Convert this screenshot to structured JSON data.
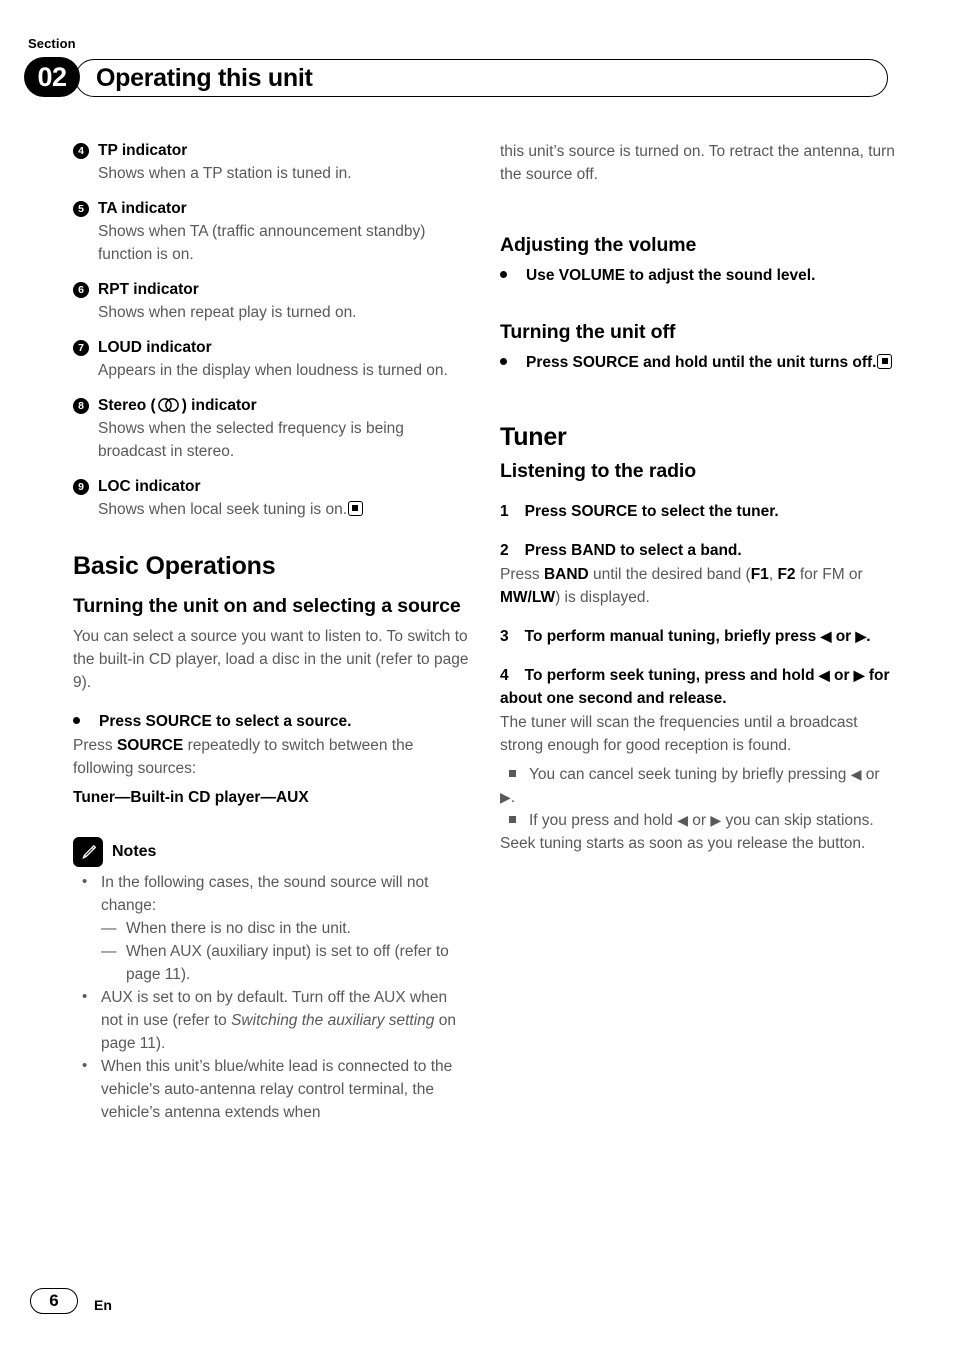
{
  "header": {
    "section_label": "Section",
    "section_number": "02",
    "title": "Operating this unit"
  },
  "left_column": {
    "indicators": [
      {
        "number": "4",
        "title": "TP indicator",
        "body": "Shows when a TP station is tuned in."
      },
      {
        "number": "5",
        "title": "TA indicator",
        "body": "Shows when TA (traffic announcement standby) function is on."
      },
      {
        "number": "6",
        "title": "RPT indicator",
        "body": "Shows when repeat play is turned on."
      },
      {
        "number": "7",
        "title": "LOUD indicator",
        "body": "Appears in the display when loudness is turned on."
      },
      {
        "number": "8",
        "title_before": "Stereo (",
        "title_symbol": "stereo-symbol",
        "title_after": ") indicator",
        "body": "Shows when the selected frequency is being broadcast in stereo."
      },
      {
        "number": "9",
        "title": "LOC indicator",
        "body": "Shows when local seek tuning is on."
      }
    ],
    "basic_operations_heading": "Basic Operations",
    "turning_on_heading": "Turning the unit on and selecting a source",
    "turning_on_para": "You can select a source you want to listen to. To switch to the built-in CD player, load a disc in the unit (refer to page 9).",
    "press_source_bullet": "Press SOURCE to select a source.",
    "press_source_para_1": "Press ",
    "press_source_bold": "SOURCE",
    "press_source_para_2": " repeatedly to switch between the following sources:",
    "source_chain": "Tuner—Built-in CD player—AUX",
    "notes_label": "Notes",
    "notes": [
      {
        "text": "In the following cases, the sound source will not change:",
        "sub_items": [
          "When there is no disc in the unit.",
          "When AUX (auxiliary input) is set to off (refer to page 11)."
        ]
      },
      {
        "text_1": "AUX is set to on by default. Turn off the AUX when not in use (refer to ",
        "italic": "Switching the auxiliary setting",
        "text_2": " on page 11)."
      },
      {
        "text": "When this unit’s blue/white lead is connected to the vehicle's auto-antenna relay control terminal, the vehicle’s antenna extends when"
      }
    ]
  },
  "right_column": {
    "continued_para": "this unit’s source is turned on. To retract the antenna, turn the source off.",
    "volume_heading": "Adjusting the volume",
    "volume_bullet": "Use VOLUME to adjust the sound level.",
    "turn_off_heading": "Turning the unit off",
    "turn_off_bullet": "Press SOURCE and hold until the unit turns off.",
    "tuner_heading": "Tuner",
    "listening_heading": "Listening to the radio",
    "steps": [
      {
        "number": "1",
        "text": "Press SOURCE to select the tuner."
      },
      {
        "number": "2",
        "text": "Press BAND to select a band.",
        "body_1": "Press ",
        "body_bold_1": "BAND",
        "body_2": " until the desired band (",
        "body_bold_2": "F1",
        "body_3": ", ",
        "body_bold_3": "F2",
        "body_4": " for FM or ",
        "body_bold_4": "MW/LW",
        "body_5": ") is displayed."
      },
      {
        "number": "3",
        "text_1": "To perform manual tuning, briefly press ",
        "arrow_left": "◀",
        "text_or": " or ",
        "arrow_right": "▶",
        "text_2": "."
      },
      {
        "number": "4",
        "text_1": "To perform seek tuning, press and hold ",
        "arrow_left": "◀",
        "text_or": " or ",
        "arrow_right": "▶",
        "text_2": " for about one second and release.",
        "body": "The tuner will scan the frequencies until a broadcast strong enough for good reception is found."
      }
    ],
    "square_notes": [
      {
        "text_1": "You can cancel seek tuning by briefly pressing ",
        "arrow_left": "◀",
        "text_or": " or ",
        "arrow_right": "▶",
        "text_2": "."
      },
      {
        "text_1": "If you press and hold ",
        "arrow_left": "◀",
        "text_or": " or ",
        "arrow_right": "▶",
        "text_2": " you can skip stations. Seek tuning starts as soon as you release the button."
      }
    ]
  },
  "footer": {
    "page_number": "6",
    "language": "En"
  }
}
